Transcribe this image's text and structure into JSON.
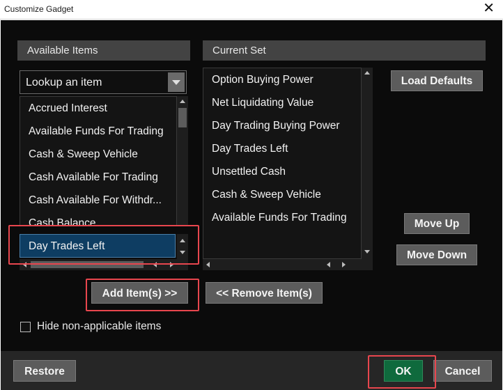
{
  "window": {
    "title": "Customize Gadget",
    "close_glyph": "✕"
  },
  "available": {
    "header": "Available Items",
    "lookup_placeholder": "Lookup an item",
    "items": [
      "Accrued Interest",
      "Available Funds For Trading",
      "Cash & Sweep Vehicle",
      "Cash Available For Trading",
      "Cash Available For Withdr...",
      "Cash Balance"
    ],
    "selected_item": "Day Trades Left"
  },
  "current": {
    "header": "Current Set",
    "items": [
      "Option Buying Power",
      "Net Liquidating Value",
      "Day Trading Buying Power",
      "Day Trades Left",
      "Unsettled Cash",
      "Cash & Sweep Vehicle",
      "Available Funds For Trading"
    ]
  },
  "buttons": {
    "load_defaults": "Load Defaults",
    "move_up": "Move Up",
    "move_down": "Move Down",
    "add_items": "Add Item(s) >>",
    "remove_items": "<< Remove Item(s)",
    "restore": "Restore",
    "ok": "OK",
    "cancel": "Cancel"
  },
  "options": {
    "hide_non_applicable": "Hide non-applicable items",
    "hide_non_applicable_checked": false
  },
  "colors": {
    "dialog_bg": "#0b0b0b",
    "header_bg": "#434343",
    "selection": "#0e3d62",
    "ok": "#0f6a3d",
    "highlight": "#e8464e"
  }
}
